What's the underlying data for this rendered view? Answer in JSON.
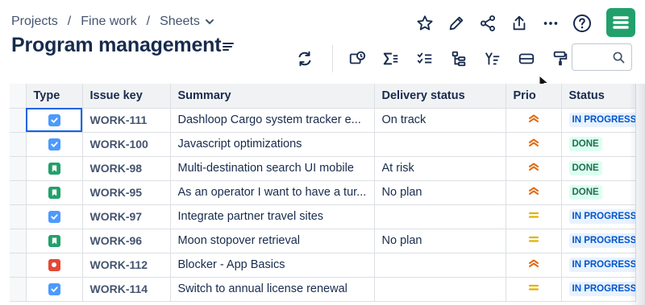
{
  "breadcrumb": {
    "items": [
      "Projects",
      "Fine work",
      "Sheets"
    ],
    "separator": "/"
  },
  "page": {
    "title": "Program management"
  },
  "colors": {
    "story": "#22a06b",
    "task": "#4c9aff",
    "bug": "#e34935",
    "prio_high": "#e56910",
    "prio_medium": "#e2b203",
    "logo": "#22a06b"
  },
  "top_actions": [
    "star-icon",
    "edit-pencil-icon",
    "share-icon",
    "export-icon",
    "more-icon",
    "help-icon"
  ],
  "toolbar_icons": [
    "refresh-icon",
    "bulk-edit-icon",
    "sum-icon",
    "checklist-icon",
    "hierarchy-icon",
    "filter-sort-icon",
    "row-height-icon",
    "format-paint-icon"
  ],
  "search": {
    "placeholder": ""
  },
  "table": {
    "columns": [
      "Type",
      "Issue key",
      "Summary",
      "Delivery status",
      "Prio",
      "Status"
    ],
    "rows": [
      {
        "type": "task",
        "key": "WORK-111",
        "summary": "Dashloop Cargo system tracker e...",
        "delivery": "On track",
        "prio": "high",
        "status": "IN PROGRESS",
        "status_kind": "progress"
      },
      {
        "type": "task",
        "key": "WORK-100",
        "summary": "Javascript optimizations",
        "delivery": "",
        "prio": "high",
        "status": "DONE",
        "status_kind": "done"
      },
      {
        "type": "story",
        "key": "WORK-98",
        "summary": "Multi-destination search UI mobile",
        "delivery": "At risk",
        "prio": "high",
        "status": "DONE",
        "status_kind": "done"
      },
      {
        "type": "story",
        "key": "WORK-95",
        "summary": "As an operator I want to have a tur...",
        "delivery": "No plan",
        "prio": "high",
        "status": "DONE",
        "status_kind": "done"
      },
      {
        "type": "task",
        "key": "WORK-97",
        "summary": "Integrate partner travel sites",
        "delivery": "",
        "prio": "medium",
        "status": "IN PROGRESS",
        "status_kind": "progress"
      },
      {
        "type": "story",
        "key": "WORK-96",
        "summary": "Moon stopover retrieval",
        "delivery": "No plan",
        "prio": "medium",
        "status": "IN PROGRESS",
        "status_kind": "progress"
      },
      {
        "type": "bug",
        "key": "WORK-112",
        "summary": "Blocker - App Basics",
        "delivery": "",
        "prio": "high",
        "status": "IN PROGRESS",
        "status_kind": "progress"
      },
      {
        "type": "task",
        "key": "WORK-114",
        "summary": "Switch to annual license renewal",
        "delivery": "",
        "prio": "medium",
        "status": "IN PROGRESS",
        "status_kind": "progress"
      }
    ]
  }
}
